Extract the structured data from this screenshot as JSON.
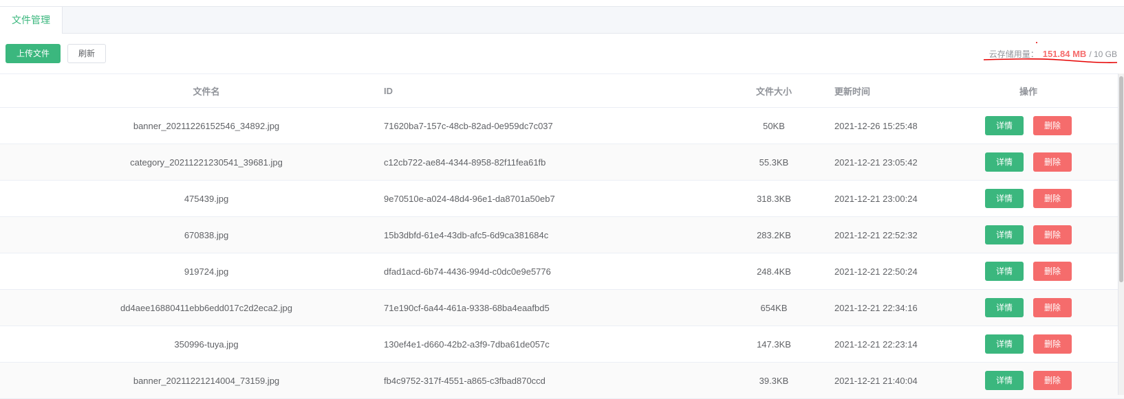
{
  "tab": {
    "label": "文件管理"
  },
  "toolbar": {
    "upload_label": "上传文件",
    "refresh_label": "刷新",
    "usage_label": "云存储用量：",
    "usage_used": "151.84 MB",
    "usage_total": "/ 10 GB"
  },
  "colors": {
    "accent": "#3bb77e",
    "danger": "#f56c6c"
  },
  "table": {
    "headers": {
      "name": "文件名",
      "id": "ID",
      "size": "文件大小",
      "time": "更新时间",
      "op": "操作"
    },
    "action_labels": {
      "detail": "详情",
      "delete": "删除"
    },
    "rows": [
      {
        "name": "banner_20211226152546_34892.jpg",
        "id": "71620ba7-157c-48cb-82ad-0e959dc7c037",
        "size": "50KB",
        "time": "2021-12-26 15:25:48"
      },
      {
        "name": "category_20211221230541_39681.jpg",
        "id": "c12cb722-ae84-4344-8958-82f11fea61fb",
        "size": "55.3KB",
        "time": "2021-12-21 23:05:42"
      },
      {
        "name": "475439.jpg",
        "id": "9e70510e-a024-48d4-96e1-da8701a50eb7",
        "size": "318.3KB",
        "time": "2021-12-21 23:00:24"
      },
      {
        "name": "670838.jpg",
        "id": "15b3dbfd-61e4-43db-afc5-6d9ca381684c",
        "size": "283.2KB",
        "time": "2021-12-21 22:52:32"
      },
      {
        "name": "919724.jpg",
        "id": "dfad1acd-6b74-4436-994d-c0dc0e9e5776",
        "size": "248.4KB",
        "time": "2021-12-21 22:50:24"
      },
      {
        "name": "dd4aee16880411ebb6edd017c2d2eca2.jpg",
        "id": "71e190cf-6a44-461a-9338-68ba4eaafbd5",
        "size": "654KB",
        "time": "2021-12-21 22:34:16"
      },
      {
        "name": "350996-tuya.jpg",
        "id": "130ef4e1-d660-42b2-a3f9-7dba61de057c",
        "size": "147.3KB",
        "time": "2021-12-21 22:23:14"
      },
      {
        "name": "banner_20211221214004_73159.jpg",
        "id": "fb4c9752-317f-4551-a865-c3fbad870ccd",
        "size": "39.3KB",
        "time": "2021-12-21 21:40:04"
      }
    ]
  }
}
